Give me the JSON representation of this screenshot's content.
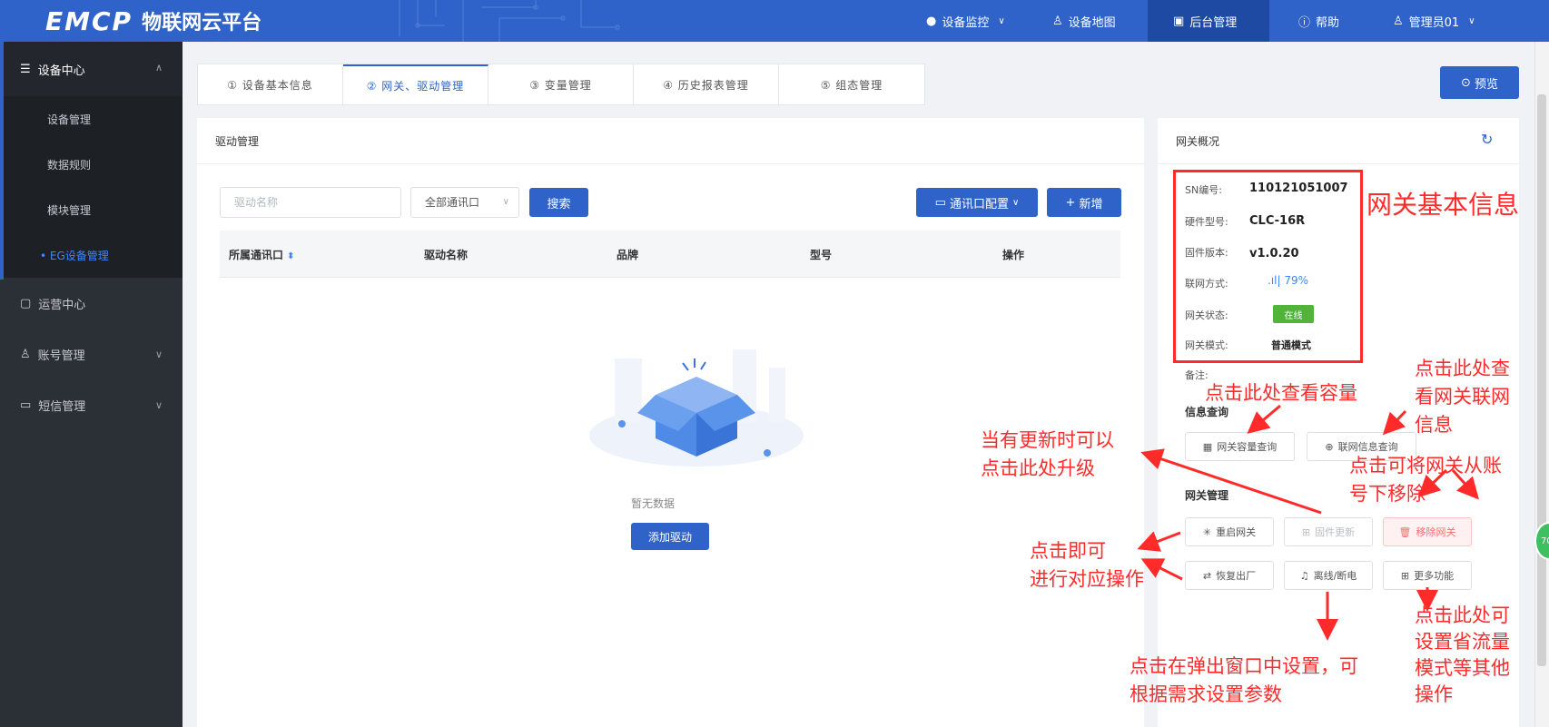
{
  "header": {
    "logo": "EMCP",
    "title": "物联网云平台",
    "nav": [
      {
        "label": "设备监控",
        "icon": "location-icon",
        "dropdown": true
      },
      {
        "label": "设备地图",
        "icon": "map-user-icon",
        "dropdown": false
      },
      {
        "label": "后台管理",
        "icon": "monitor-icon",
        "dropdown": false,
        "active": true
      },
      {
        "label": "帮助",
        "icon": "help-icon",
        "dropdown": false
      },
      {
        "label": "管理员01",
        "icon": "user-icon",
        "dropdown": true
      }
    ]
  },
  "sidebar": {
    "groups": [
      {
        "label": "设备中心",
        "icon": "device-center-icon",
        "open": true,
        "items": [
          "设备管理",
          "数据规则",
          "模块管理",
          "• EG设备管理"
        ]
      },
      {
        "label": "运营中心",
        "icon": "operation-icon",
        "open": false
      },
      {
        "label": "账号管理",
        "icon": "account-icon",
        "open": false
      },
      {
        "label": "短信管理",
        "icon": "sms-icon",
        "open": false
      }
    ],
    "active_item": "• EG设备管理"
  },
  "tabs": [
    "① 设备基本信息",
    "② 网关、驱动管理",
    "③ 变量管理",
    "④ 历史报表管理",
    "⑤ 组态管理"
  ],
  "active_tab": "② 网关、驱动管理",
  "preview_button": "预览",
  "driver_panel": {
    "title": "驱动管理",
    "search_placeholder": "驱动名称",
    "port_select": "全部通讯口",
    "search_button": "搜索",
    "port_config_button": "通讯口配置",
    "add_button": "新增",
    "columns": [
      "所属通讯口",
      "驱动名称",
      "品牌",
      "型号",
      "操作"
    ],
    "empty_text": "暂无数据",
    "add_driver_button": "添加驱动"
  },
  "gateway_panel": {
    "title": "网关概况",
    "info": [
      {
        "label": "SN编号:",
        "value": "110121051007"
      },
      {
        "label": "硬件型号:",
        "value": "CLC-16R"
      },
      {
        "label": "固件版本:",
        "value": "v1.0.20"
      },
      {
        "label": "联网方式:",
        "value": "79%"
      },
      {
        "label": "网关状态:",
        "value": "在线"
      },
      {
        "label": "网关模式:",
        "value": "普通模式"
      }
    ],
    "remark_label": "备注:",
    "info_query_title": "信息查询",
    "capacity_query_button": "网关容量查询",
    "network_query_button": "联网信息查询",
    "gateway_mgmt_title": "网关管理",
    "restart_button": "重启网关",
    "firmware_update_button": "固件更新",
    "remove_button": "移除网关",
    "factory_reset_button": "恢复出厂",
    "offline_button": "离线/断电",
    "more_button": "更多功能"
  },
  "annotations": {
    "basic_info": "网关基本信息",
    "capacity": "点击此处查看容量",
    "network": [
      "点击此处查",
      "看网关联网",
      "信息"
    ],
    "upgrade": [
      "当有更新时可以",
      "点击此处升级"
    ],
    "remove": [
      "点击可将网关从账",
      "号下移除"
    ],
    "operate": [
      "点击即可",
      "进行对应操作"
    ],
    "popup": [
      "点击在弹出窗口中设置，可",
      "根据需求设置参数"
    ],
    "more": [
      "点击此处可",
      "设置省流量",
      "模式等其他",
      "操作"
    ]
  },
  "side_bubble": "70",
  "colors": {
    "primary": "#2f63c9",
    "sidebar": "#2b2f36",
    "annotation": "#ff2a2a",
    "online": "#52b33a"
  }
}
